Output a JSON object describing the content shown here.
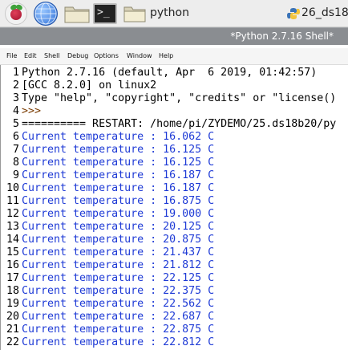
{
  "taskbar": {
    "items": [
      {
        "icon": "raspberry-pi-menu-icon"
      },
      {
        "icon": "browser-globe-icon"
      },
      {
        "icon": "file-manager-folder-icon"
      },
      {
        "icon": "terminal-icon",
        "glyph": ">_"
      },
      {
        "icon": "folder-icon",
        "label": "python"
      },
      {
        "icon": "python-file-icon",
        "label": "26_ds18b"
      }
    ]
  },
  "window": {
    "title": "*Python 2.7.16 Shell*"
  },
  "menu": [
    "File",
    "Edit",
    "Shell",
    "Debug",
    "Options",
    "Window",
    "Help"
  ],
  "colors": {
    "output_blue": "#1f3bd6",
    "prompt_brown": "#7a3b00",
    "titlebar_grey": "#8a8d91"
  },
  "lines": [
    {
      "n": "1",
      "text": "Python 2.7.16 (default, Apr  6 2019, 01:42:57)"
    },
    {
      "n": "2",
      "text": "[GCC 8.2.0] on linux2"
    },
    {
      "n": "3",
      "text": "Type \"help\", \"copyright\", \"credits\" or \"license()"
    },
    {
      "n": "4",
      "text": ">>> "
    },
    {
      "n": "5",
      "text": "========== RESTART: /home/pi/ZYDEMO/25.ds18b20/py"
    },
    {
      "n": "6",
      "text": "Current temperature : 16.062 C"
    },
    {
      "n": "7",
      "text": "Current temperature : 16.125 C"
    },
    {
      "n": "8",
      "text": "Current temperature : 16.125 C"
    },
    {
      "n": "9",
      "text": "Current temperature : 16.187 C"
    },
    {
      "n": "10",
      "text": "Current temperature : 16.187 C"
    },
    {
      "n": "11",
      "text": "Current temperature : 16.875 C"
    },
    {
      "n": "12",
      "text": "Current temperature : 19.000 C"
    },
    {
      "n": "13",
      "text": "Current temperature : 20.125 C"
    },
    {
      "n": "14",
      "text": "Current temperature : 20.875 C"
    },
    {
      "n": "15",
      "text": "Current temperature : 21.437 C"
    },
    {
      "n": "16",
      "text": "Current temperature : 21.812 C"
    },
    {
      "n": "17",
      "text": "Current temperature : 22.125 C"
    },
    {
      "n": "18",
      "text": "Current temperature : 22.375 C"
    },
    {
      "n": "19",
      "text": "Current temperature : 22.562 C"
    },
    {
      "n": "20",
      "text": "Current temperature : 22.687 C"
    },
    {
      "n": "21",
      "text": "Current temperature : 22.875 C"
    },
    {
      "n": "22",
      "text": "Current temperature : 22.812 C"
    }
  ]
}
